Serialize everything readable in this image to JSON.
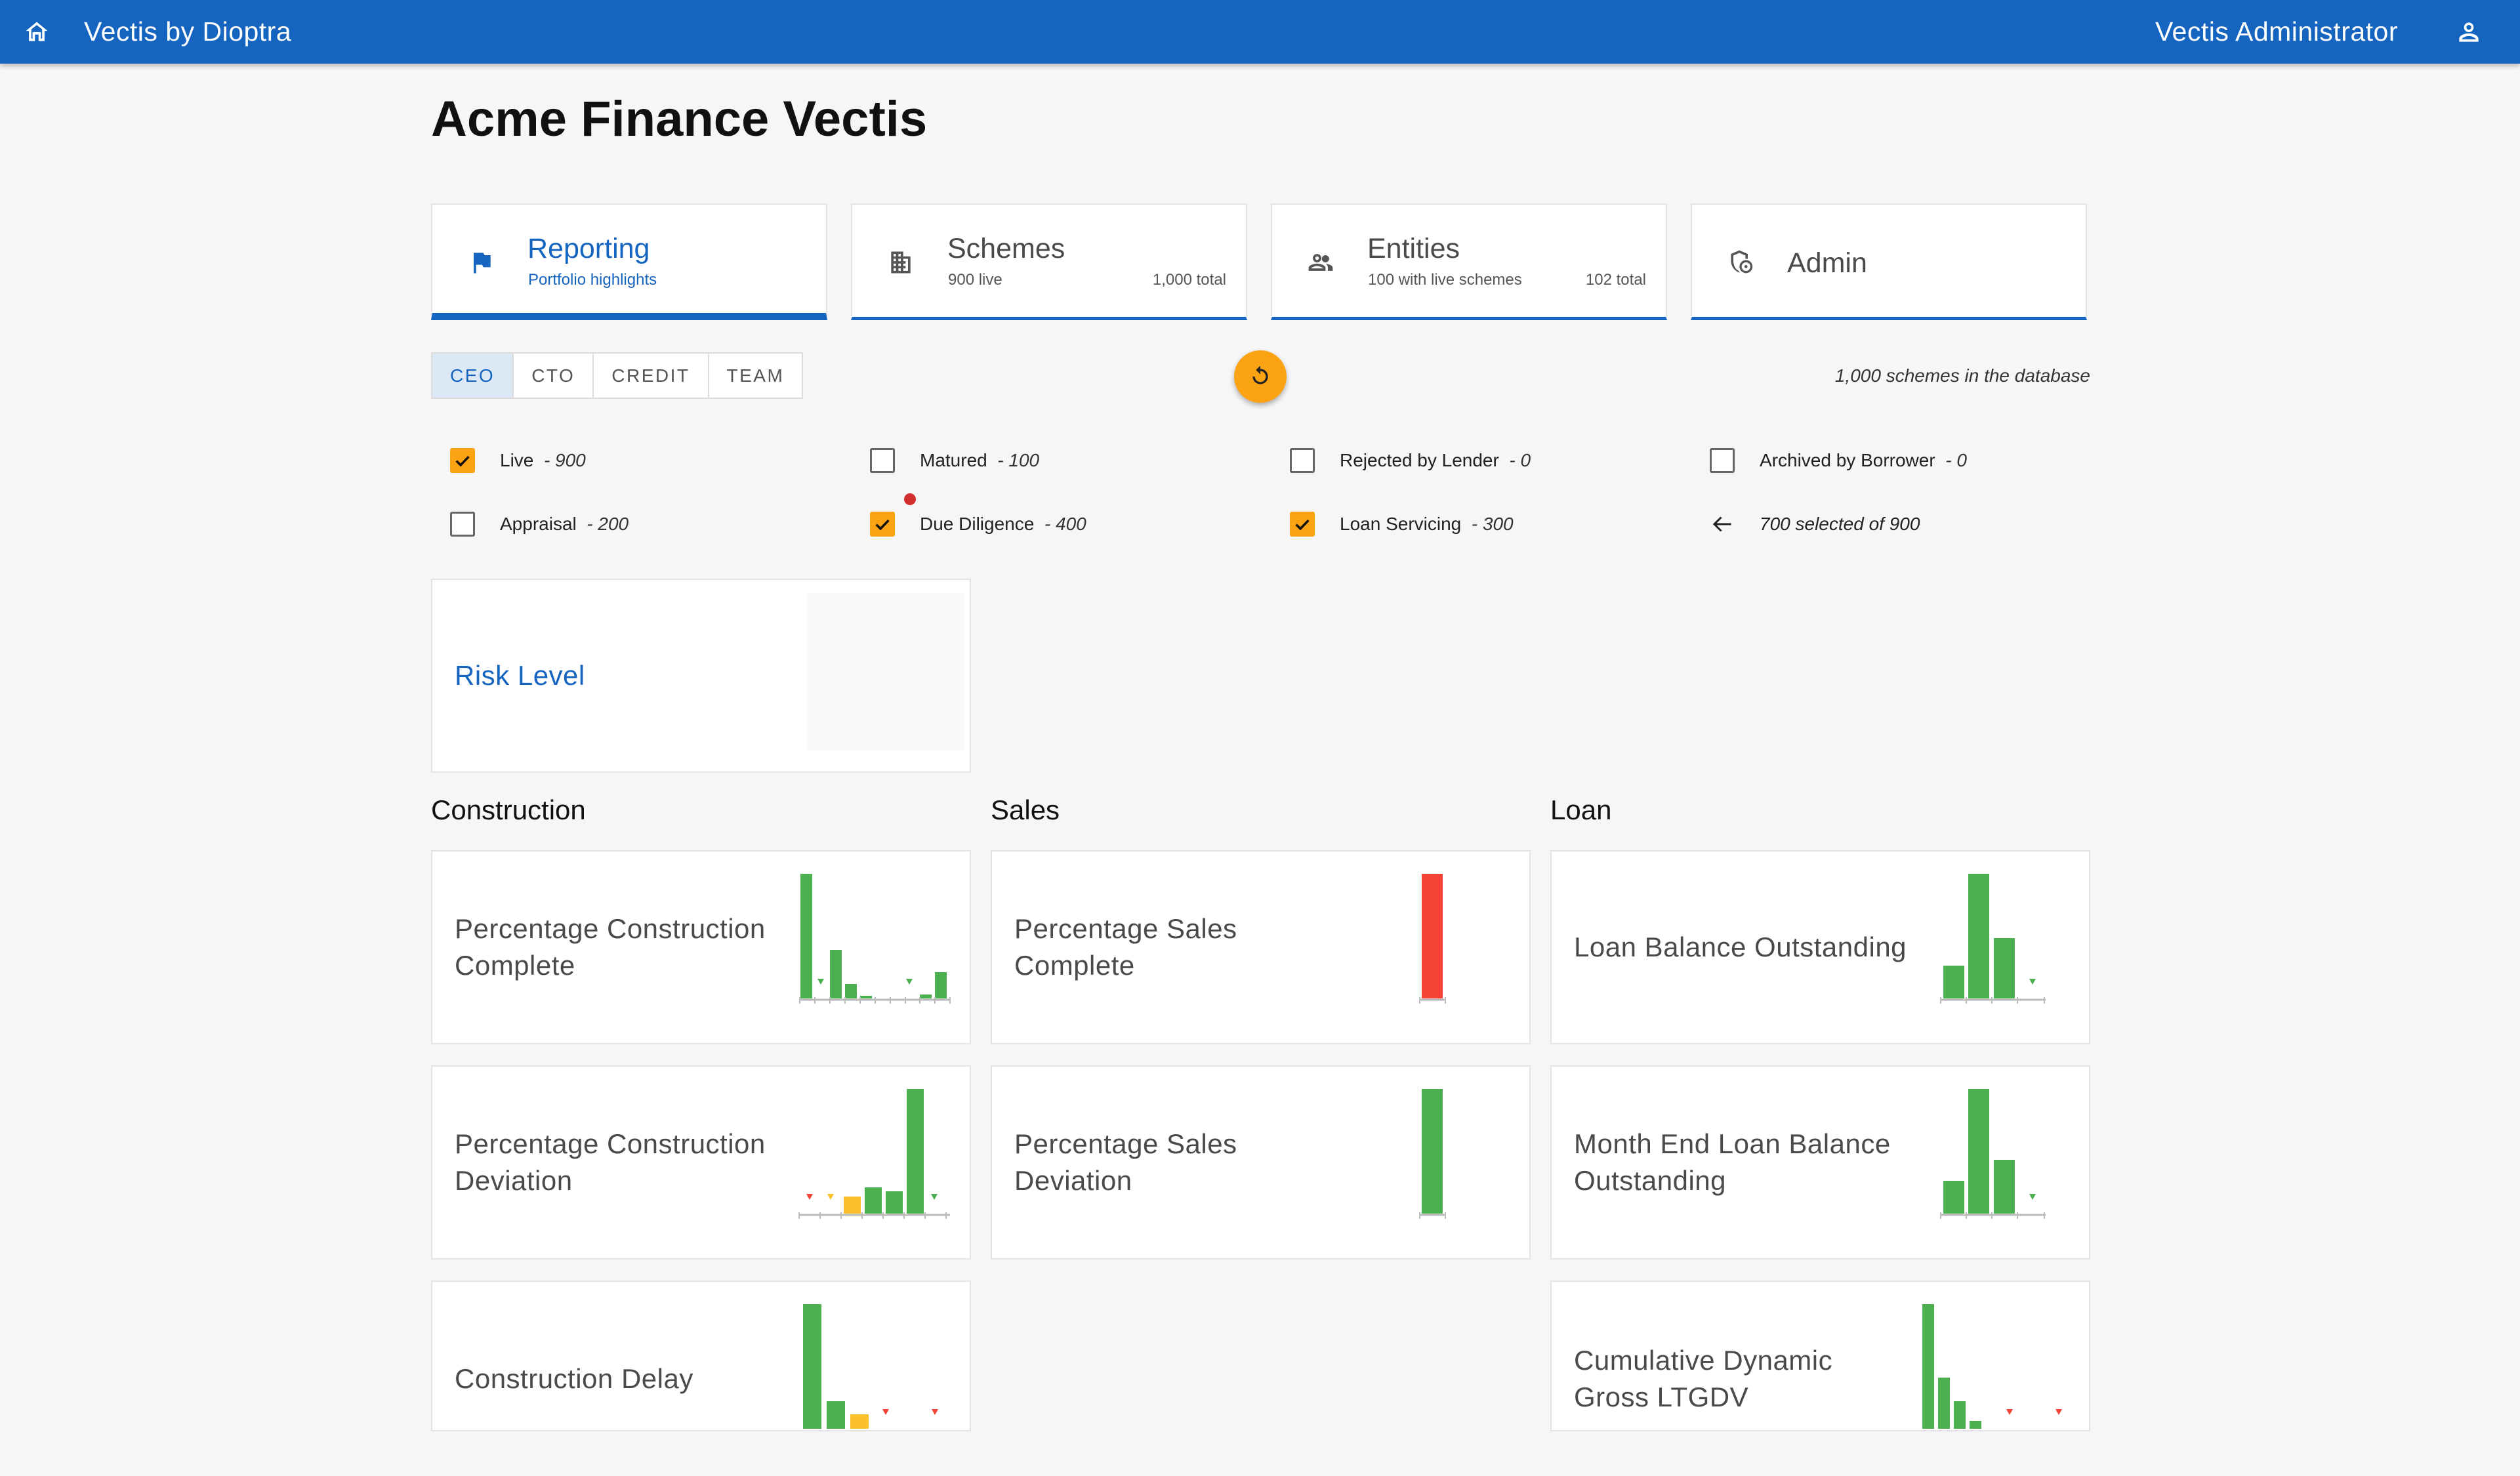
{
  "app": {
    "brand": "Vectis by Dioptra",
    "user": "Vectis Administrator"
  },
  "page_title": "Acme Finance Vectis",
  "tabs": [
    {
      "label": "Reporting",
      "sub": "Portfolio highlights",
      "right": ""
    },
    {
      "label": "Schemes",
      "sub": "900 live",
      "right": "1,000 total"
    },
    {
      "label": "Entities",
      "sub": "100 with live schemes",
      "right": "102 total"
    },
    {
      "label": "Admin",
      "sub": "",
      "right": ""
    }
  ],
  "views": [
    "CEO",
    "CTO",
    "CREDIT",
    "TEAM"
  ],
  "selected_view": "CEO",
  "db_count": "1,000 schemes in the database",
  "filters": [
    {
      "label": "Live",
      "count": "- 900",
      "checked": true
    },
    {
      "label": "Matured",
      "count": "- 100",
      "checked": false
    },
    {
      "label": "Rejected by Lender",
      "count": "- 0",
      "checked": false
    },
    {
      "label": "Archived by Borrower",
      "count": "- 0",
      "checked": false
    },
    {
      "label": "Appraisal",
      "count": "- 200",
      "checked": false
    },
    {
      "label": "Due Diligence",
      "count": "- 400",
      "checked": true
    },
    {
      "label": "Loan Servicing",
      "count": "- 300",
      "checked": true
    }
  ],
  "selection_summary": "700 selected of 900",
  "sections": {
    "construction": "Construction",
    "sales": "Sales",
    "loan": "Loan"
  },
  "cards": {
    "risk": "Risk Level",
    "pct_construction_complete": "Percentage Construction Complete",
    "pct_construction_deviation": "Percentage Construction Deviation",
    "construction_delay": "Construction Delay",
    "pct_sales_complete": "Percentage Sales Complete",
    "pct_sales_deviation": "Percentage Sales Deviation",
    "loan_balance": "Loan Balance Outstanding",
    "month_end_loan_balance": "Month End Loan Balance Outstanding",
    "cumulative_ltgdv": "Cumulative Dynamic Gross LTGDV"
  },
  "colors": {
    "primary": "#1565c0",
    "accent": "#fba313",
    "good": "#4caf50",
    "warn": "#fbc02d",
    "bad": "#f44336"
  }
}
